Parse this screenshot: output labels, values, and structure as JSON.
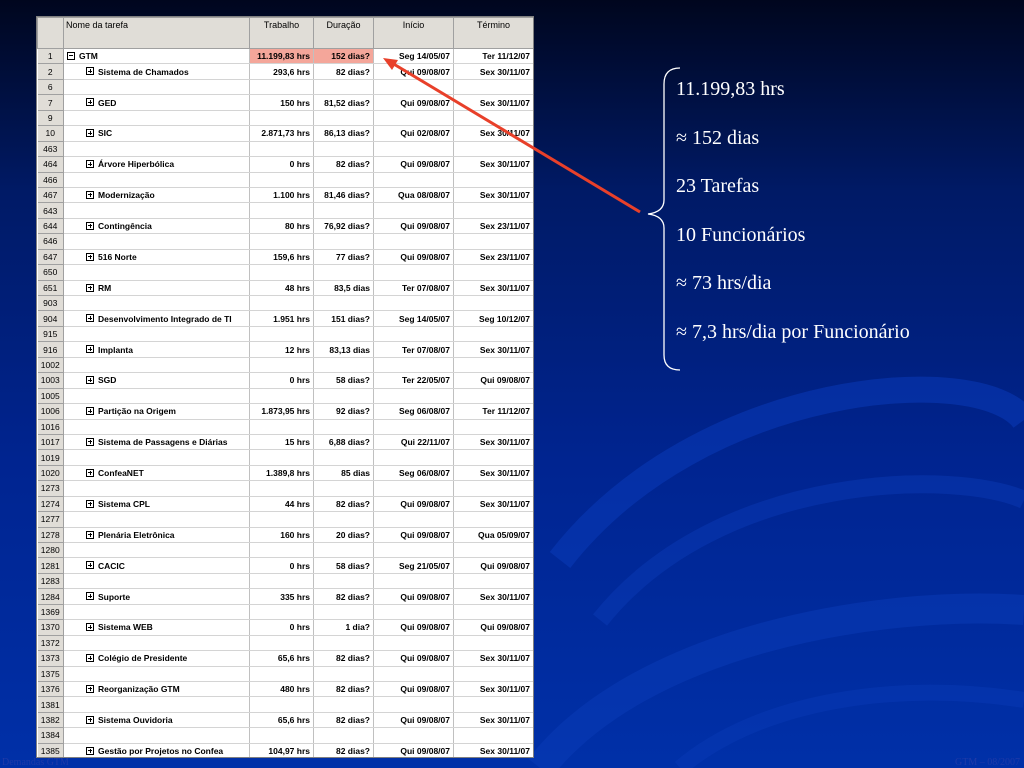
{
  "table": {
    "headers": {
      "name": "Nome da tarefa",
      "work": "Trabalho",
      "duration": "Duração",
      "start": "Início",
      "end": "Término"
    },
    "rows": [
      {
        "id": "1",
        "name": "GTM",
        "work": "11.199,83 hrs",
        "duration": "152 dias?",
        "start": "Seg 14/05/07",
        "end": "Ter 11/12/07",
        "summary": true,
        "expanded": true
      },
      {
        "id": "2",
        "name": "Sistema de Chamados",
        "work": "293,6 hrs",
        "duration": "82 dias?",
        "start": "Qui 09/08/07",
        "end": "Sex 30/11/07",
        "summary": true
      },
      {
        "id": "6"
      },
      {
        "id": "7",
        "name": "GED",
        "work": "150 hrs",
        "duration": "81,52 dias?",
        "start": "Qui 09/08/07",
        "end": "Sex 30/11/07",
        "summary": true
      },
      {
        "id": "9"
      },
      {
        "id": "10",
        "name": "SIC",
        "work": "2.871,73 hrs",
        "duration": "86,13 dias?",
        "start": "Qui 02/08/07",
        "end": "Sex 30/11/07",
        "summary": true
      },
      {
        "id": "463"
      },
      {
        "id": "464",
        "name": "Árvore Hiperbólica",
        "work": "0 hrs",
        "duration": "82 dias?",
        "start": "Qui 09/08/07",
        "end": "Sex 30/11/07",
        "summary": true
      },
      {
        "id": "466"
      },
      {
        "id": "467",
        "name": "Modernização",
        "work": "1.100 hrs",
        "duration": "81,46 dias?",
        "start": "Qua 08/08/07",
        "end": "Sex 30/11/07",
        "summary": true
      },
      {
        "id": "643"
      },
      {
        "id": "644",
        "name": "Contingência",
        "work": "80 hrs",
        "duration": "76,92 dias?",
        "start": "Qui 09/08/07",
        "end": "Sex 23/11/07",
        "summary": true
      },
      {
        "id": "646"
      },
      {
        "id": "647",
        "name": "516 Norte",
        "work": "159,6 hrs",
        "duration": "77 dias?",
        "start": "Qui 09/08/07",
        "end": "Sex 23/11/07",
        "summary": true
      },
      {
        "id": "650"
      },
      {
        "id": "651",
        "name": "RM",
        "work": "48 hrs",
        "duration": "83,5 dias",
        "start": "Ter 07/08/07",
        "end": "Sex 30/11/07",
        "summary": true
      },
      {
        "id": "903"
      },
      {
        "id": "904",
        "name": "Desenvolvimento Integrado de TI",
        "work": "1.951 hrs",
        "duration": "151 dias?",
        "start": "Seg 14/05/07",
        "end": "Seg 10/12/07",
        "summary": true
      },
      {
        "id": "915"
      },
      {
        "id": "916",
        "name": "Implanta",
        "work": "12 hrs",
        "duration": "83,13 dias",
        "start": "Ter 07/08/07",
        "end": "Sex 30/11/07",
        "summary": true
      },
      {
        "id": "1002"
      },
      {
        "id": "1003",
        "name": "SGD",
        "work": "0 hrs",
        "duration": "58 dias?",
        "start": "Ter 22/05/07",
        "end": "Qui 09/08/07",
        "summary": true
      },
      {
        "id": "1005"
      },
      {
        "id": "1006",
        "name": "Partição na Origem",
        "work": "1.873,95 hrs",
        "duration": "92 dias?",
        "start": "Seg 06/08/07",
        "end": "Ter 11/12/07",
        "summary": true
      },
      {
        "id": "1016"
      },
      {
        "id": "1017",
        "name": "Sistema de Passagens e Diárias",
        "work": "15 hrs",
        "duration": "6,88 dias?",
        "start": "Qui 22/11/07",
        "end": "Sex 30/11/07",
        "summary": true
      },
      {
        "id": "1019"
      },
      {
        "id": "1020",
        "name": "ConfeaNET",
        "work": "1.389,8 hrs",
        "duration": "85 dias",
        "start": "Seg 06/08/07",
        "end": "Sex 30/11/07",
        "summary": true
      },
      {
        "id": "1273"
      },
      {
        "id": "1274",
        "name": "Sistema CPL",
        "work": "44 hrs",
        "duration": "82 dias?",
        "start": "Qui 09/08/07",
        "end": "Sex 30/11/07",
        "summary": true
      },
      {
        "id": "1277"
      },
      {
        "id": "1278",
        "name": "Plenária Eletrônica",
        "work": "160 hrs",
        "duration": "20 dias?",
        "start": "Qui 09/08/07",
        "end": "Qua 05/09/07",
        "summary": true
      },
      {
        "id": "1280"
      },
      {
        "id": "1281",
        "name": "CACIC",
        "work": "0 hrs",
        "duration": "58 dias?",
        "start": "Seg 21/05/07",
        "end": "Qui 09/08/07",
        "summary": true
      },
      {
        "id": "1283"
      },
      {
        "id": "1284",
        "name": "Suporte",
        "work": "335 hrs",
        "duration": "82 dias?",
        "start": "Qui 09/08/07",
        "end": "Sex 30/11/07",
        "summary": true
      },
      {
        "id": "1369"
      },
      {
        "id": "1370",
        "name": "Sistema WEB",
        "work": "0 hrs",
        "duration": "1 dia?",
        "start": "Qui 09/08/07",
        "end": "Qui 09/08/07",
        "summary": true
      },
      {
        "id": "1372"
      },
      {
        "id": "1373",
        "name": "Colégio de Presidente",
        "work": "65,6 hrs",
        "duration": "82 dias?",
        "start": "Qui 09/08/07",
        "end": "Sex 30/11/07",
        "summary": true
      },
      {
        "id": "1375"
      },
      {
        "id": "1376",
        "name": "Reorganização GTM",
        "work": "480 hrs",
        "duration": "82 dias?",
        "start": "Qui 09/08/07",
        "end": "Sex 30/11/07",
        "summary": true
      },
      {
        "id": "1381"
      },
      {
        "id": "1382",
        "name": "Sistema Ouvidoria",
        "work": "65,6 hrs",
        "duration": "82 dias?",
        "start": "Qui 09/08/07",
        "end": "Sex 30/11/07",
        "summary": true
      },
      {
        "id": "1384"
      },
      {
        "id": "1385",
        "name": "Gestão por Projetos no Confea",
        "work": "104,97 hrs",
        "duration": "82 dias?",
        "start": "Qui 09/08/07",
        "end": "Sex 30/11/07",
        "summary": true
      }
    ]
  },
  "stats": [
    "11.199,83 hrs",
    "≈  152 dias",
    "23 Tarefas",
    "10 Funcionários",
    "≈ 73 hrs/dia",
    "≈ 7,3 hrs/dia por Funcionário"
  ],
  "footer": {
    "left": "Demandas GTM",
    "right": "GTM – 08/2007"
  },
  "colors": {
    "highlight": "#f4a69a",
    "arrow": "#e8402a",
    "background": "#002490"
  },
  "icons": {
    "collapse": "minus-box-icon",
    "expand": "plus-box-icon"
  }
}
